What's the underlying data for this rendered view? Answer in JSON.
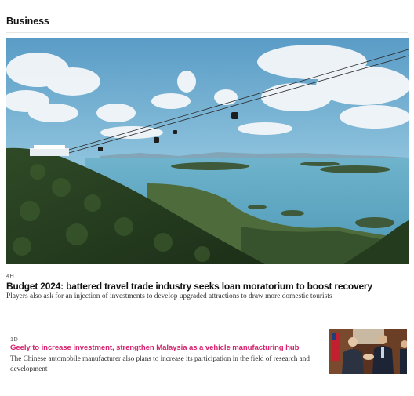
{
  "section": {
    "title": "Business"
  },
  "hero": {
    "image_icon": "cable-car-landscape-photo",
    "meta": "4H",
    "title": "Budget 2024: battered travel trade industry seeks loan moratorium to boost recovery",
    "summary": "Players also ask for an injection of investments to develop upgraded attractions to draw more domestic tourists"
  },
  "story2": {
    "meta": "1D",
    "title": "Geely to increase investment, strengthen Malaysia as a vehicle manufacturing hub",
    "summary": "The Chinese automobile manufacturer also plans to increase its participation in the field of research and development",
    "image_icon": "handshake-photo"
  },
  "colors": {
    "accent": "#d6246e",
    "text": "#111111"
  }
}
